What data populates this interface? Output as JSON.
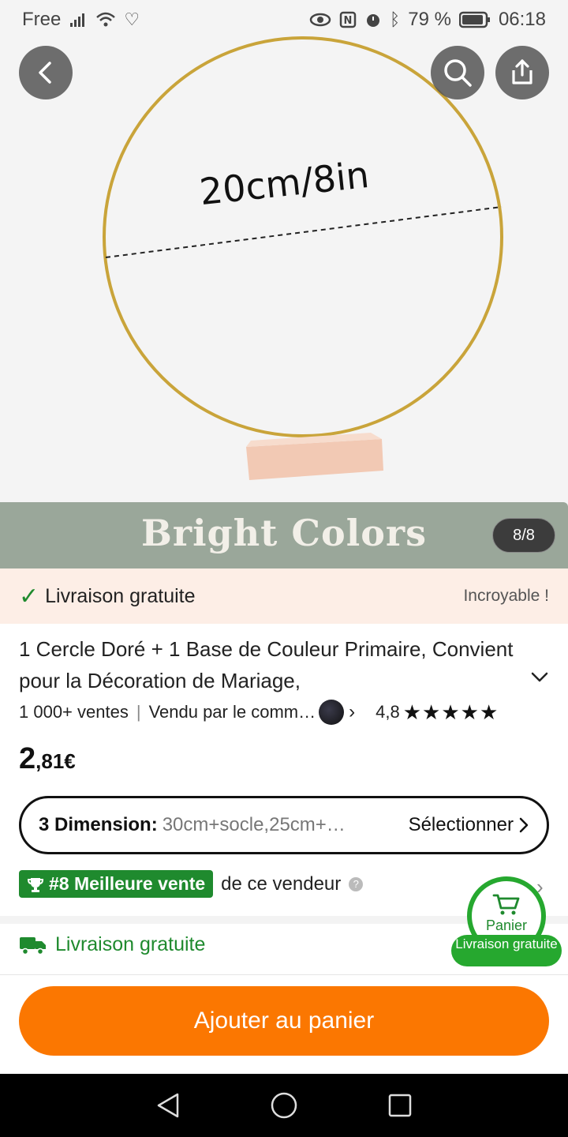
{
  "status_bar": {
    "carrier": "Free",
    "battery": "79 %",
    "time": "06:18"
  },
  "hero": {
    "image_caption": "20cm/8in",
    "band_text": "Bright Colors",
    "counter": "8/8"
  },
  "shipping_banner": {
    "label": "Livraison gratuite",
    "tag": "Incroyable !"
  },
  "product": {
    "title": "1 Cercle Doré + 1 Base de Couleur Primaire, Convient pour la Décoration de Mariage,",
    "sales": "1 000+ ventes",
    "seller": "Vendu par le comm…",
    "rating": "4,8",
    "stars": "★★★★★",
    "price_int": "2",
    "price_dec": ",81€"
  },
  "dimension": {
    "label": "3 Dimension:",
    "value": "30cm+socle,25cm+…",
    "select_label": "Sélectionner"
  },
  "bestseller": {
    "badge": "#8 Meilleure vente",
    "suffix": "de ce vendeur",
    "help": "?"
  },
  "delivery": {
    "label": "Livraison gratuite"
  },
  "floating_cart": {
    "label": "Panier",
    "tag": "Livraison gratuite"
  },
  "bottom": {
    "add_to_cart": "Ajouter au panier"
  },
  "colors": {
    "accent_orange": "#fb7701",
    "green": "#1f8a2e",
    "gold_ring": "#c9a43a",
    "base_pink": "#f2c9b4"
  }
}
